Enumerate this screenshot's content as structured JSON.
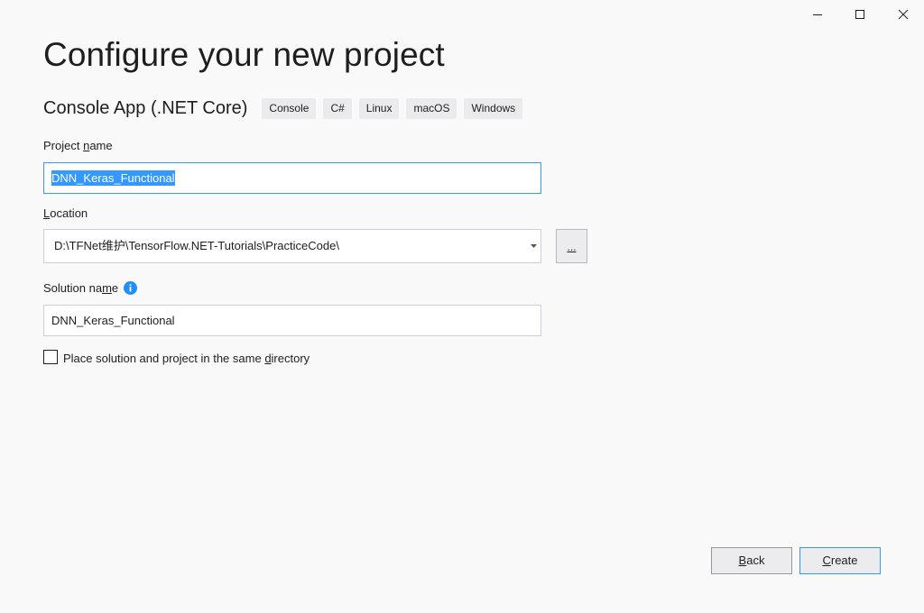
{
  "window": {
    "controls": [
      "minimize-icon",
      "maximize-icon",
      "close-icon"
    ]
  },
  "page_title": "Configure your new project",
  "template": {
    "name": "Console App (.NET Core)",
    "tags": [
      "Console",
      "C#",
      "Linux",
      "macOS",
      "Windows"
    ]
  },
  "project_name": {
    "label_pre": "Project ",
    "label_u": "n",
    "label_post": "ame",
    "value": "DNN_Keras_Functional"
  },
  "location": {
    "label_pre": "",
    "label_u": "L",
    "label_post": "ocation",
    "value": "D:\\TFNet维护\\TensorFlow.NET-Tutorials\\PracticeCode\\",
    "browse_label": "..."
  },
  "solution_name": {
    "label_pre": "Solution na",
    "label_u": "m",
    "label_post": "e",
    "value": "DNN_Keras_Functional"
  },
  "same_directory": {
    "label_pre": "Place solution and project in the same ",
    "label_u": "d",
    "label_post": "irectory",
    "checked": false
  },
  "buttons": {
    "back_u": "B",
    "back_post": "ack",
    "create_u": "C",
    "create_post": "reate"
  },
  "colors": {
    "accent": "#3399ff",
    "info": "#1e90ff",
    "background": "#f9f9fa"
  }
}
